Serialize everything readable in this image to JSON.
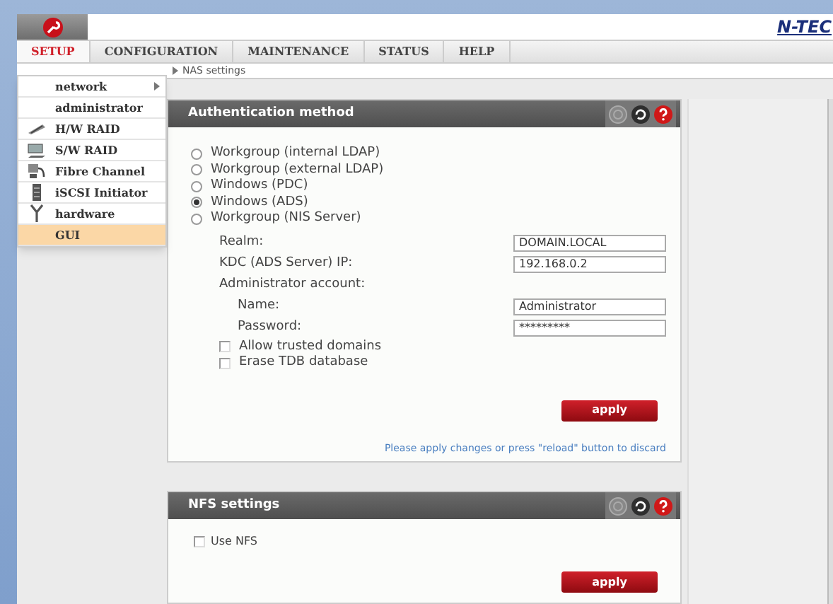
{
  "header": {
    "logo": "N-TEC"
  },
  "nav": {
    "tabs": [
      {
        "label": "SETUP",
        "selected": true
      },
      {
        "label": "CONFIGURATION",
        "selected": false
      },
      {
        "label": "MAINTENANCE",
        "selected": false
      },
      {
        "label": "STATUS",
        "selected": false
      },
      {
        "label": "HELP",
        "selected": false
      }
    ]
  },
  "breadcrumb": "NAS settings",
  "menu": {
    "items": [
      {
        "label": "network",
        "has_icon": false,
        "submenu": true,
        "selected": false
      },
      {
        "label": "administrator",
        "has_icon": false,
        "submenu": false,
        "selected": false
      },
      {
        "label": "H/W RAID",
        "has_icon": true,
        "submenu": false,
        "selected": false
      },
      {
        "label": "S/W RAID",
        "has_icon": true,
        "submenu": false,
        "selected": false
      },
      {
        "label": "Fibre Channel",
        "has_icon": true,
        "submenu": false,
        "selected": false
      },
      {
        "label": "iSCSI Initiator",
        "has_icon": true,
        "submenu": false,
        "selected": false
      },
      {
        "label": "hardware",
        "has_icon": true,
        "submenu": false,
        "selected": false
      },
      {
        "label": "GUI",
        "has_icon": false,
        "submenu": false,
        "selected": true
      }
    ]
  },
  "auth_panel": {
    "title": "Authentication method",
    "options": [
      {
        "label": "Workgroup (internal LDAP)",
        "selected": false
      },
      {
        "label": "Workgroup (external LDAP)",
        "selected": false
      },
      {
        "label": "Windows (PDC)",
        "selected": false
      },
      {
        "label": "Windows (ADS)",
        "selected": true
      },
      {
        "label": "Workgroup (NIS Server)",
        "selected": false
      }
    ],
    "fields": [
      {
        "label": "Realm:",
        "value": "DOMAIN.LOCAL"
      },
      {
        "label": "KDC (ADS Server) IP:",
        "value": "192.168.0.2"
      },
      {
        "label": "Administrator account:",
        "children": [
          {
            "label": "Name:",
            "value": "Administrator"
          },
          {
            "label": "Password:",
            "value": "*********"
          }
        ]
      }
    ],
    "checkboxes": [
      {
        "label": "Allow trusted domains",
        "checked": false
      },
      {
        "label": "Erase TDB database",
        "checked": false
      }
    ],
    "button": "apply",
    "note": "Please apply changes or press \"reload\" button to discard"
  },
  "nfs_panel": {
    "title": "NFS settings",
    "checkboxes": [
      {
        "label": "Use NFS",
        "checked": false
      }
    ],
    "button": "apply"
  }
}
